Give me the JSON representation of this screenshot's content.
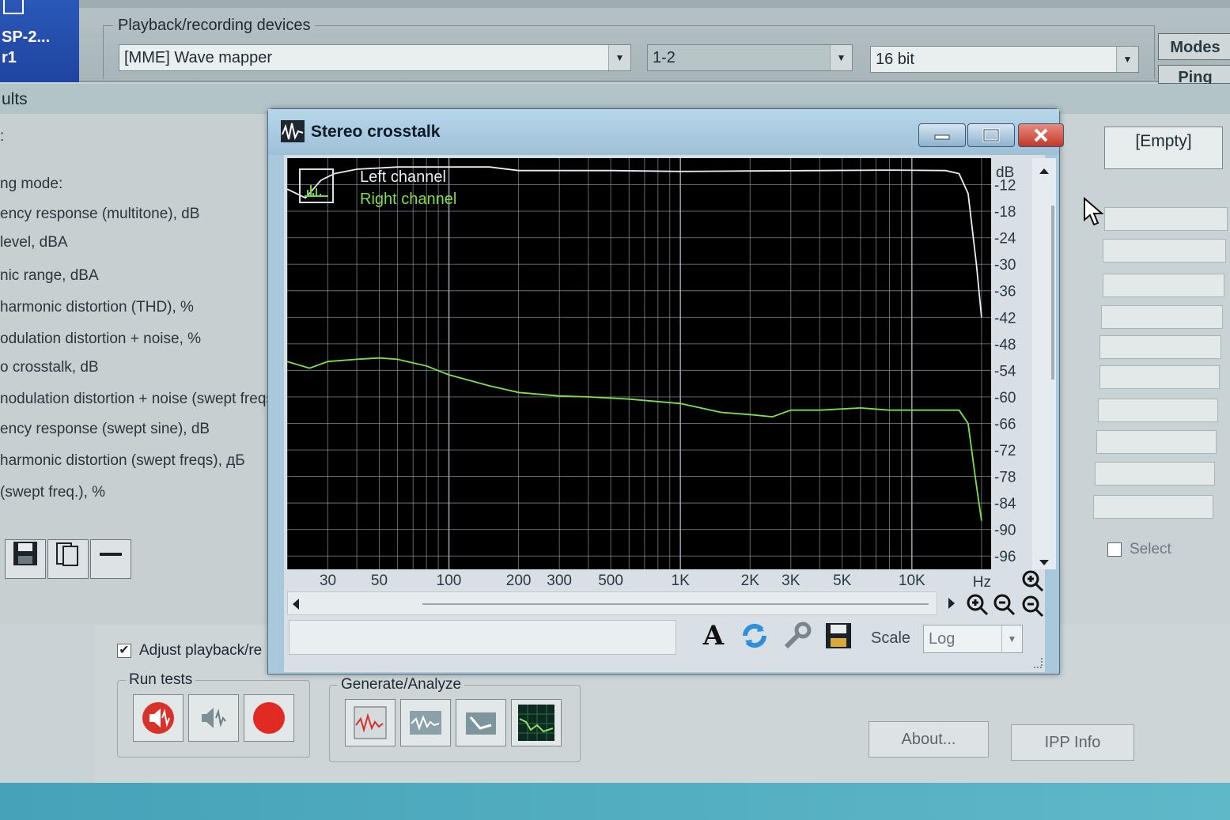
{
  "app": {
    "left_strip": {
      "line1": "SP-2...",
      "line2": "r1"
    }
  },
  "devices": {
    "legend": "Playback/recording devices",
    "device": "[MME] Wave mapper",
    "channels": "1-2",
    "bit_depth": "16 bit",
    "modes_label": "Modes",
    "ping_label": "Ping"
  },
  "results_header": "ults",
  "test_labels": [
    ":",
    "ng mode:",
    "ency response (multitone), dB",
    "level, dBA",
    "nic range, dBA",
    "harmonic distortion (THD), %",
    "odulation distortion + noise, %",
    "o crosstalk, dB",
    "nodulation distortion + noise (swept freqs",
    "ency response (swept sine), dB",
    "harmonic distortion (swept freqs), дБ",
    "(swept freq.), %"
  ],
  "bottom": {
    "adjust_label": "Adjust playback/re",
    "run_tests_legend": "Run tests",
    "generate_legend": "Generate/Analyze",
    "about_label": "About...",
    "ipp_label": "IPP Info",
    "empty_label": "[Empty]",
    "select_label": "Select"
  },
  "dialog": {
    "title": "Stereo crosstalk",
    "scale_label": "Scale",
    "scale_value": "Log",
    "colors": {
      "left": "#e8eef2",
      "right": "#7fe04a",
      "grid": "#9aa3aa"
    }
  },
  "chart_data": {
    "type": "line",
    "title": "",
    "xlabel": "Hz",
    "ylabel": "dB",
    "x_scale": "log",
    "xlim": [
      20,
      22000
    ],
    "ylim": [
      -99,
      -6
    ],
    "x_tick_labels": [
      "30",
      "50",
      "100",
      "200",
      "300",
      "500",
      "1K",
      "2K",
      "3K",
      "5K",
      "10K"
    ],
    "x_ticks": [
      30,
      50,
      100,
      200,
      300,
      500,
      1000,
      2000,
      3000,
      5000,
      10000
    ],
    "y_ticks": [
      -12,
      -18,
      -24,
      -30,
      -36,
      -42,
      -48,
      -54,
      -60,
      -66,
      -72,
      -78,
      -84,
      -90,
      -96
    ],
    "grid": true,
    "legend_position": "top-left",
    "series": [
      {
        "name": "Left channel",
        "x": [
          20,
          24,
          28,
          32,
          40,
          60,
          100,
          150,
          200,
          300,
          500,
          1000,
          2000,
          4000,
          8000,
          14000,
          16000,
          17500,
          19000,
          20000
        ],
        "y": [
          -13,
          -15,
          -11,
          -9.5,
          -8.5,
          -8,
          -8,
          -8,
          -8.8,
          -8.8,
          -8.8,
          -9,
          -8.9,
          -8.8,
          -8.7,
          -8.8,
          -9.5,
          -14,
          -30,
          -42
        ]
      },
      {
        "name": "Right channel",
        "x": [
          20,
          25,
          30,
          40,
          50,
          60,
          80,
          100,
          150,
          200,
          300,
          400,
          600,
          1000,
          1500,
          2000,
          2500,
          3000,
          4000,
          6000,
          8000,
          12000,
          16000,
          17500,
          19000,
          20000
        ],
        "y": [
          -52,
          -53.5,
          -52,
          -51.5,
          -51.2,
          -51.5,
          -53,
          -55,
          -57.5,
          -59,
          -59.8,
          -60,
          -60.5,
          -61.5,
          -63.5,
          -64,
          -64.5,
          -63,
          -63,
          -62.5,
          -63,
          -63,
          -63,
          -66,
          -80,
          -88
        ]
      }
    ]
  }
}
